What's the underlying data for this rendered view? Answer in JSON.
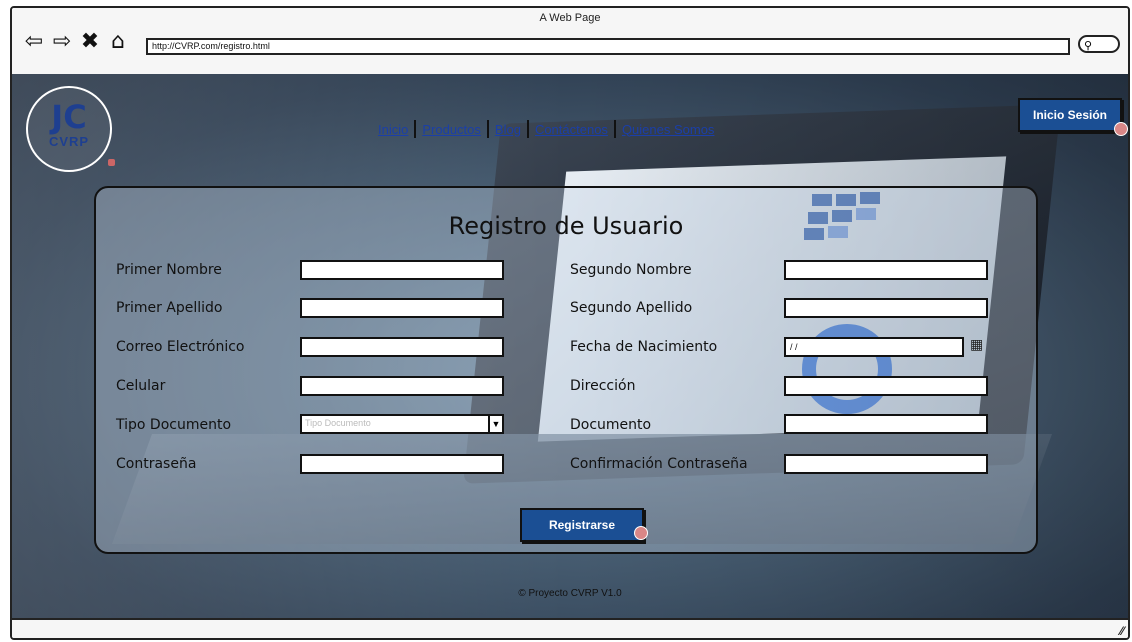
{
  "window": {
    "title": "A Web Page",
    "url": "http://CVRP.com/registro.html"
  },
  "logo": {
    "mono": "JC",
    "text": "CVRP"
  },
  "nav": {
    "inicio": "Inicio",
    "productos": "Productos",
    "blog": "Blog",
    "contactenos": "Contáctenos",
    "quienes": "Quienes Somos"
  },
  "header": {
    "login_label": "Inicio Sesión"
  },
  "form": {
    "title": "Registro de Usuario",
    "primer_nombre": "Primer Nombre",
    "segundo_nombre": "Segundo Nombre",
    "primer_apellido": "Primer Apellido",
    "segundo_apellido": "Segundo Apellido",
    "correo": "Correo Electrónico",
    "fecha": "Fecha de Nacimiento",
    "fecha_value": "/ /",
    "celular": "Celular",
    "direccion": "Dirección",
    "tipo_documento": "Tipo Documento",
    "tipo_documento_placeholder": "Tipo Documento",
    "documento": "Documento",
    "contrasena": "Contraseña",
    "confirmacion": "Confirmación Contraseña",
    "submit_label": "Registrarse"
  },
  "footer": {
    "text": "© Proyecto CVRP V1.0"
  },
  "colors": {
    "primary_button": "#1b4f94",
    "link": "#1b3fa8"
  }
}
